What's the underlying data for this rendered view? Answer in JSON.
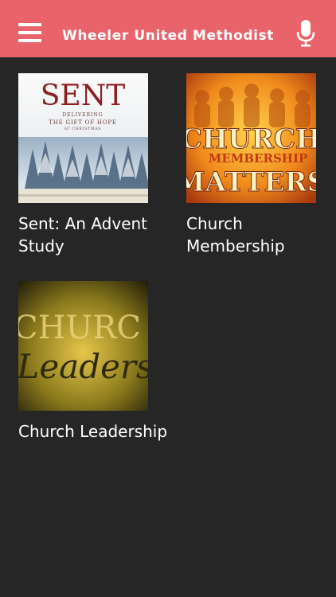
{
  "header": {
    "title": "Wheeler United Methodist",
    "menu_icon": "hamburger-menu-icon",
    "mic_icon": "microphone-icon",
    "bg_color": "#e8646a"
  },
  "items": [
    {
      "title": "Sent: An Advent Study",
      "thumb": {
        "headline": "SENT",
        "line1": "DELIVERING",
        "line2": "THE GIFT OF HOPE",
        "line3": "AT CHRISTMAS"
      }
    },
    {
      "title": "Church Membership",
      "thumb": {
        "line1": "CHURCH",
        "line2": "MEMBERSHIP",
        "line3": "MATTERS"
      }
    },
    {
      "title": "Church Leadership",
      "thumb": {
        "line1": "CHURC",
        "line2": "Leaders"
      }
    }
  ]
}
